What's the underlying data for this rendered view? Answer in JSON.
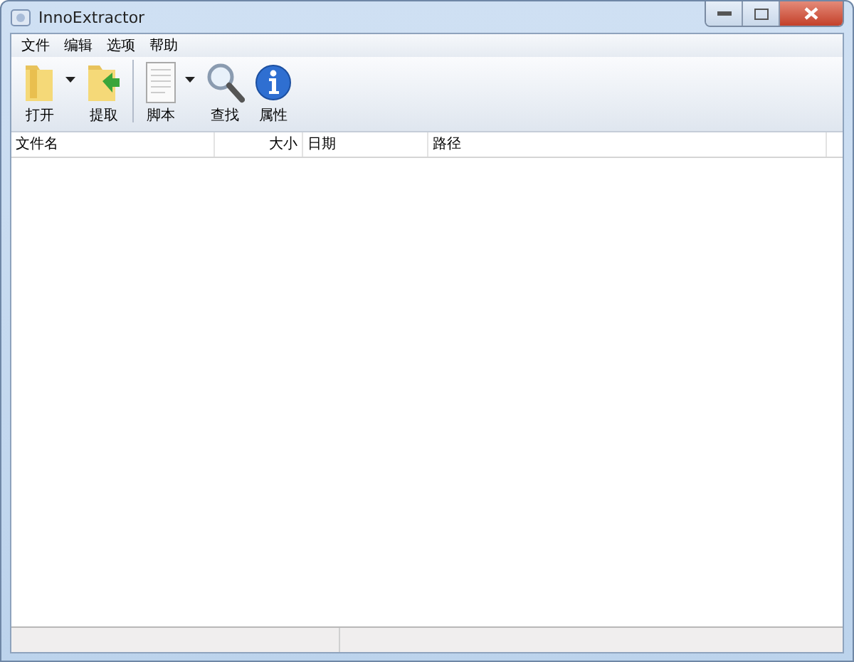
{
  "window": {
    "title": "InnoExtractor"
  },
  "menu": [
    "文件",
    "编辑",
    "选项",
    "帮助"
  ],
  "toolbar": {
    "groups": [
      [
        {
          "label": "打开",
          "dropdown": true
        },
        {
          "label": "提取",
          "dropdown": false
        }
      ],
      [
        {
          "label": "脚本",
          "dropdown": true
        },
        {
          "label": "查找",
          "dropdown": false
        },
        {
          "label": "属性",
          "dropdown": false
        }
      ]
    ]
  },
  "table": {
    "columns": [
      {
        "label": "文件名"
      },
      {
        "label": "大小"
      },
      {
        "label": "日期"
      },
      {
        "label": "路径"
      }
    ]
  }
}
